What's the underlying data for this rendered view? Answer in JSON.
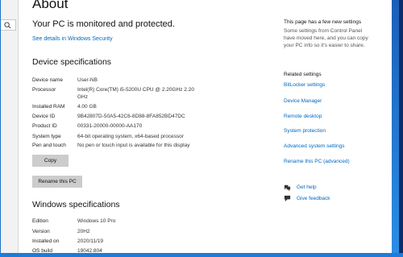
{
  "page": {
    "title": "About",
    "protection_status": "Your PC is monitored and protected.",
    "security_link": "See details in Windows Security"
  },
  "device_specs": {
    "heading": "Device specifications",
    "rows": [
      {
        "label": "Device name",
        "value": "User-NB"
      },
      {
        "label": "Processor",
        "value": "Intel(R) Core(TM) i5-5200U CPU @ 2.20GHz   2.20 GHz"
      },
      {
        "label": "Installed RAM",
        "value": "4.00 GB"
      },
      {
        "label": "Device ID",
        "value": "9B42807D-50A5-42C6-8D88-8FA852BD47DC"
      },
      {
        "label": "Product ID",
        "value": "00331-20000-00000-AA170"
      },
      {
        "label": "System type",
        "value": "64-bit operating system, x64-based processor"
      },
      {
        "label": "Pen and touch",
        "value": "No pen or touch input is available for this display"
      }
    ],
    "copy_button": "Copy",
    "rename_button": "Rename this PC"
  },
  "windows_specs": {
    "heading": "Windows specifications",
    "rows": [
      {
        "label": "Edition",
        "value": "Windows 10 Pro"
      },
      {
        "label": "Version",
        "value": "20H2"
      },
      {
        "label": "Installed on",
        "value": "2020/11/19"
      },
      {
        "label": "OS build",
        "value": "19042.804"
      }
    ]
  },
  "sidebar": {
    "notice_title": "This page has a few new settings",
    "notice_text": "Some settings from Control Panel have moved here, and you can copy your PC info so it's easier to share.",
    "related_title": "Related settings",
    "related_links": [
      "BitLocker settings",
      "Device Manager",
      "Remote desktop",
      "System protection",
      "Advanced system settings",
      "Rename this PC (advanced)"
    ],
    "help_link": "Get help",
    "feedback_link": "Give feedback"
  },
  "icons": {
    "search": "search-icon",
    "help": "help-icon",
    "feedback": "feedback-icon"
  },
  "colors": {
    "link": "#0067c0",
    "button_bg": "#cccccc",
    "accent": "#1e7bd8"
  }
}
